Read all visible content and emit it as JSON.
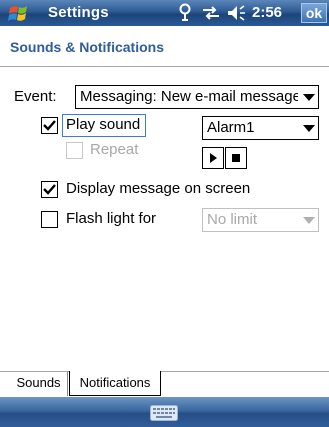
{
  "titlebar": {
    "title": "Settings",
    "clock": "2:56",
    "ok_label": "ok",
    "icons": [
      "start-flag-icon",
      "signal-icon",
      "connectivity-icon",
      "volume-icon"
    ]
  },
  "page": {
    "title": "Sounds & Notifications"
  },
  "form": {
    "event_label": "Event:",
    "event_value": "Messaging: New e-mail message",
    "play_sound_label": "Play sound",
    "play_sound_checked": true,
    "sound_value": "Alarm1",
    "repeat_label": "Repeat",
    "repeat_checked": false,
    "display_message_label": "Display message on screen",
    "display_message_checked": true,
    "flash_light_label": "Flash light for",
    "flash_light_checked": false,
    "flash_duration_value": "No limit"
  },
  "tabs": [
    {
      "label": "Sounds",
      "selected": false
    },
    {
      "label": "Notifications",
      "selected": true
    }
  ],
  "softbar": {
    "icon": "keyboard-icon"
  },
  "colors": {
    "title_bar": "#2d5a94",
    "page_title": "#2f5d9b",
    "focus": "#3a7fc8"
  }
}
